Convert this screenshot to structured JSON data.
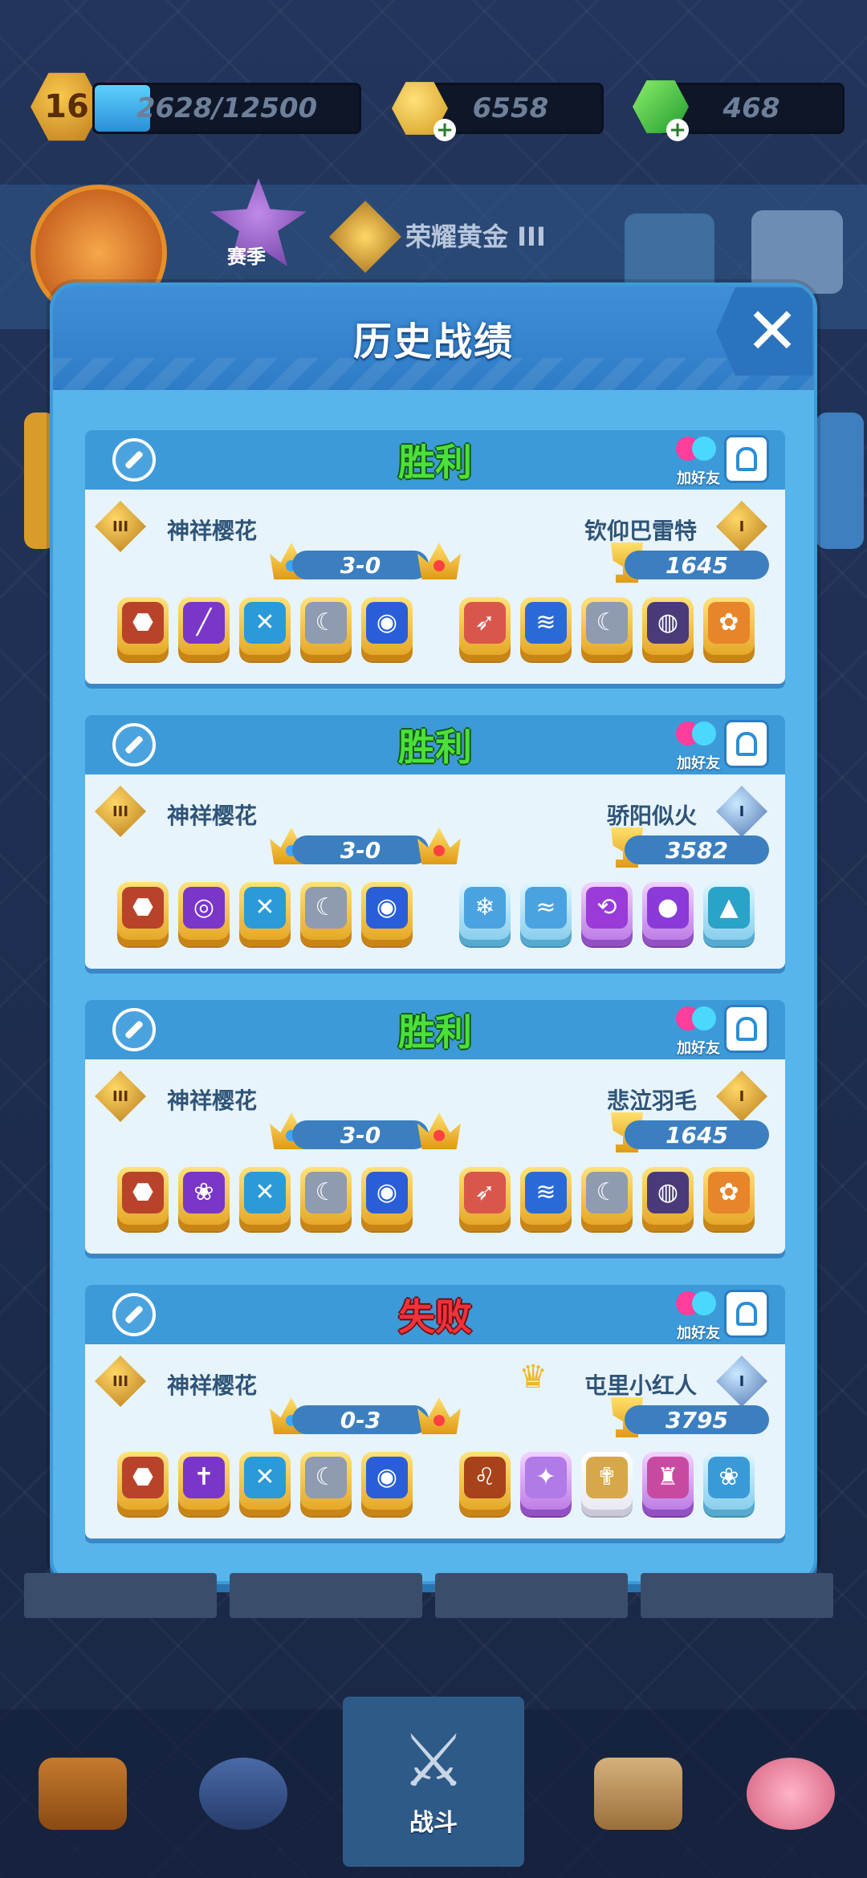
{
  "top_bar": {
    "level": "16",
    "xp_text": "2628/12500",
    "xp_progress": 0.21,
    "gold": "6558",
    "gems": "468",
    "icons": {
      "gold": "gold-coin-icon",
      "gem": "green-gem-icon",
      "plus": "plus-icon"
    }
  },
  "profile": {
    "season_label": "赛季",
    "rank_name": "荣耀黄金 III"
  },
  "modal": {
    "title": "历史战绩",
    "close_icon": "close-icon"
  },
  "matches": [
    {
      "result": "胜利",
      "result_type": "win",
      "add_friend_label": "加好友",
      "player_name": "神祥樱花",
      "opponent_name": "钦仰巴雷特",
      "score": "3-0",
      "trophies": "1645",
      "opponent_rank": "gold",
      "player_dice": [
        "⬣",
        "╱",
        "✕",
        "☾",
        "◉"
      ],
      "opponent_dice": [
        "➶",
        "≋",
        "☾",
        "◍",
        "✿"
      ]
    },
    {
      "result": "胜利",
      "result_type": "win",
      "add_friend_label": "加好友",
      "player_name": "神祥樱花",
      "opponent_name": "骄阳似火",
      "score": "3-0",
      "trophies": "3582",
      "opponent_rank": "platinum",
      "player_dice": [
        "⬣",
        "◎",
        "✕",
        "☾",
        "◉"
      ],
      "opponent_dice": [
        "❄",
        "≈",
        "⟲",
        "●",
        "▲"
      ]
    },
    {
      "result": "胜利",
      "result_type": "win",
      "add_friend_label": "加好友",
      "player_name": "神祥樱花",
      "opponent_name": "悲泣羽毛",
      "score": "3-0",
      "trophies": "1645",
      "opponent_rank": "gold",
      "player_dice": [
        "⬣",
        "❀",
        "✕",
        "☾",
        "◉"
      ],
      "opponent_dice": [
        "➶",
        "≋",
        "☾",
        "◍",
        "✿"
      ]
    },
    {
      "result": "失败",
      "result_type": "lose",
      "add_friend_label": "加好友",
      "player_name": "神祥樱花",
      "opponent_name": "屯里小红人",
      "score": "0-3",
      "trophies": "3795",
      "opponent_rank": "platinum",
      "player_dice": [
        "⬣",
        "✝",
        "✕",
        "☾",
        "◉"
      ],
      "opponent_dice": [
        "♌",
        "✦",
        "✟",
        "♜",
        "❀"
      ]
    }
  ],
  "bottom_nav": {
    "battle_label": "战斗"
  }
}
